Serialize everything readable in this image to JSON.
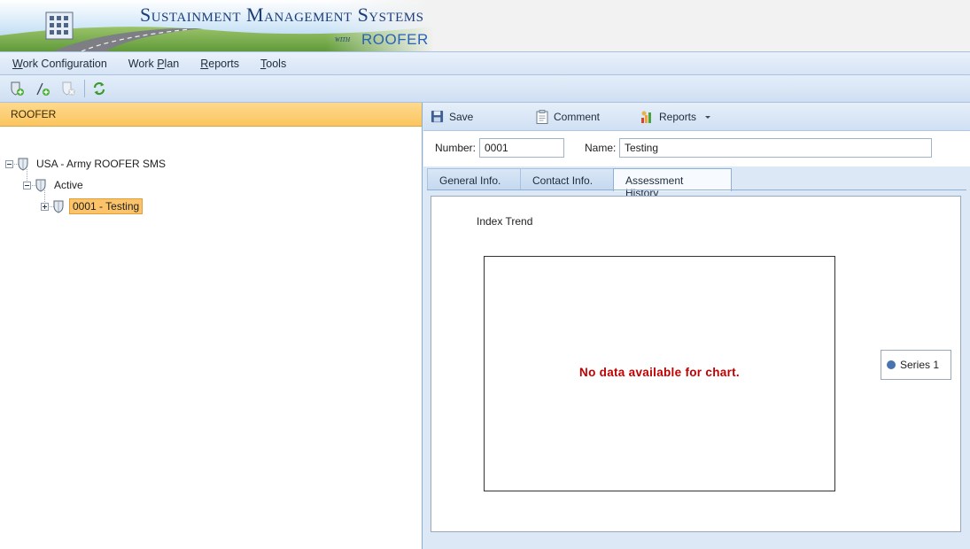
{
  "banner": {
    "title": "Sustainment Management Systems",
    "with": "with",
    "product": "ROOFER"
  },
  "menu": {
    "items": [
      {
        "label": "Work Configuration",
        "accel": "W"
      },
      {
        "label": "Work Plan",
        "accel": "P"
      },
      {
        "label": "Reports",
        "accel": "R"
      },
      {
        "label": "Tools",
        "accel": "T"
      }
    ]
  },
  "toolbar": {
    "buttons": [
      "add-shield-icon",
      "add-item-icon",
      "delete-shield-icon",
      "refresh-icon"
    ]
  },
  "left": {
    "header": "ROOFER",
    "tree": {
      "root": "USA - Army ROOFER SMS",
      "active": "Active",
      "item": "0001 - Testing"
    }
  },
  "right": {
    "actions": {
      "save": "Save",
      "comment": "Comment",
      "reports": "Reports"
    },
    "fields": {
      "number_label": "Number:",
      "number_value": "0001",
      "name_label": "Name:",
      "name_value": "Testing"
    },
    "tabs": [
      {
        "label": "General Info.",
        "active": false
      },
      {
        "label": "Contact Info.",
        "active": false
      },
      {
        "label": "Assessment History",
        "active": true
      }
    ]
  },
  "chart_data": {
    "type": "line",
    "title": "Index Trend",
    "message": "No data available for chart.",
    "series": [
      {
        "name": "Series 1",
        "values": []
      }
    ],
    "legend_position": "right",
    "series_color": "#4a74b1"
  },
  "colors": {
    "accent": "#fbc46a",
    "no_data_text": "#c00000",
    "title_blue": "#1c3d7a"
  }
}
